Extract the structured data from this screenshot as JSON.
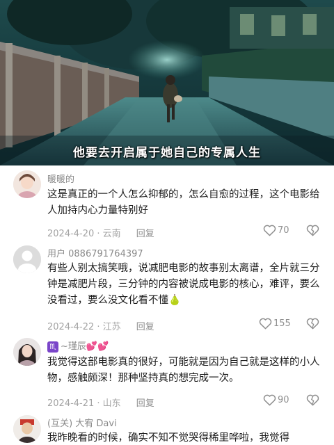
{
  "video": {
    "subtitle": "他要去开启属于她自己的专属人生"
  },
  "comments": [
    {
      "username": "暖暖的",
      "text": "这是真正的一个人怎么抑郁的，怎么自愈的过程，这个电影给人加持内心力量特别好",
      "date_location": "2024-4-20 · 云南",
      "reply_label": "回复",
      "likes": "70"
    },
    {
      "username": "用户 0886791764397",
      "text": "有些人别太搞笑哦，说减肥电影的故事别太离谱，全片就三分钟是减肥片段，三分钟的内容被说成电影的核心，难评，要么没看过，要么没文化看不懂",
      "emoji": "🍐",
      "date_location": "2024-4-22 · 江苏",
      "reply_label": "回复",
      "likes": "155"
    },
    {
      "username": "~瑾辰",
      "username_badge": "♏",
      "username_emoji": "💕💕",
      "text": "我觉得这部电影真的很好，可能就是因为自己就是这样的小人物，感触颇深！那种坚持真的想完成一次。",
      "date_location": "2024-4-21 · 山东",
      "reply_label": "回复",
      "likes": "90"
    },
    {
      "username": "(互关) 大宥 Davi",
      "text": "我昨晚看的时候，确实不知不觉哭得稀里哗啦，我觉得"
    }
  ],
  "colors": {
    "username": "#8a8a8a",
    "meta": "#a3a3a3",
    "text": "#1c1c1c",
    "badge": "#7a45c9"
  },
  "icons": {
    "like": "heart-outline-icon",
    "dislike": "broken-heart-icon"
  }
}
